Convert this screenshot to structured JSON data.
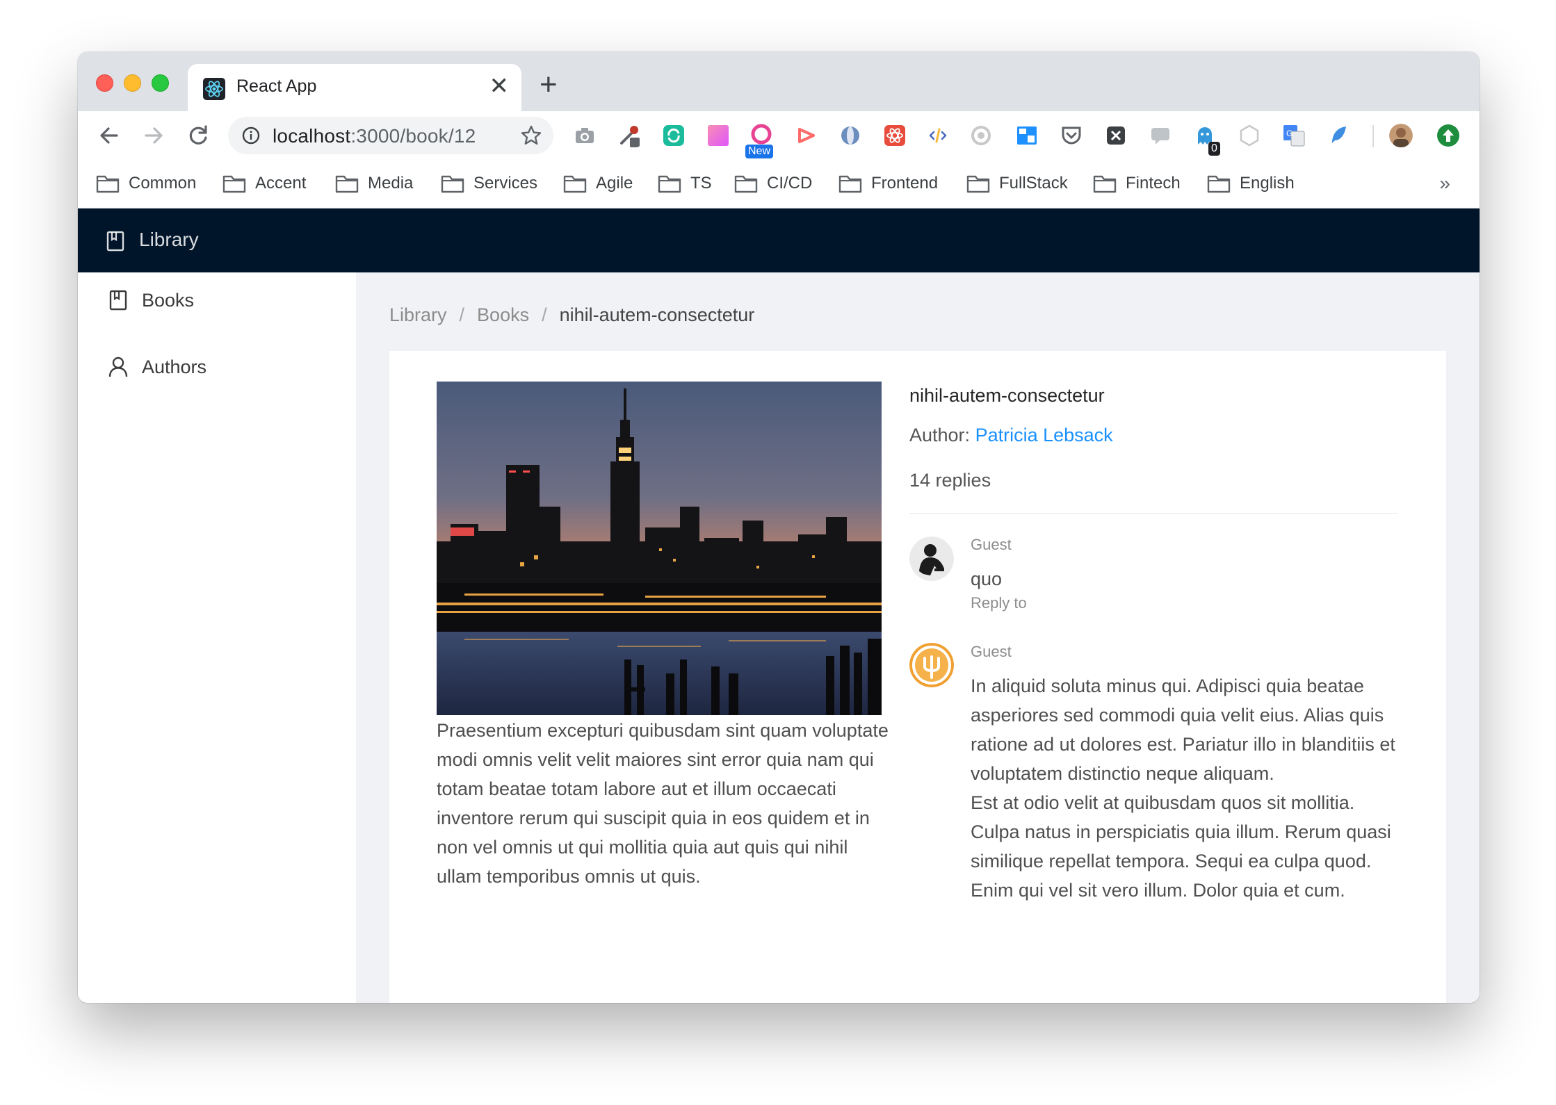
{
  "browser": {
    "tab_title": "React App",
    "tab_close": "✕",
    "new_tab": "+",
    "url_host": "localhost",
    "url_rest": ":3000/book/12",
    "extension_badge_new": "New",
    "extension_badge_count": "0",
    "more_bookmarks": "»"
  },
  "bookmarks": [
    "Common",
    "Accent",
    "Media",
    "Services",
    "Agile",
    "TS",
    "CI/CD",
    "Frontend",
    "FullStack",
    "Fintech",
    "English"
  ],
  "app": {
    "title": "Library"
  },
  "sidebar": {
    "items": [
      {
        "label": "Books",
        "icon": "book-icon"
      },
      {
        "label": "Authors",
        "icon": "user-icon"
      }
    ]
  },
  "breadcrumb": {
    "items": [
      "Library",
      "Books"
    ],
    "separator": "/",
    "current": "nihil-autem-consectetur"
  },
  "book": {
    "title": "nihil-autem-consectetur",
    "author_prefix": "Author:",
    "author_name": "Patricia Lebsack",
    "description": "Praesentium excepturi quibusdam sint quam voluptate modi omnis velit velit maiores sint error quia nam qui totam beatae totam labore aut et illum occaecati inventore rerum qui suscipit quia in eos quidem et in non vel omnis ut qui mollitia quia aut quis qui nihil ullam temporibus omnis ut quis."
  },
  "comments": {
    "count_label": "14 replies",
    "items": [
      {
        "author": "Guest",
        "body": "quo",
        "action": "Reply to"
      },
      {
        "author": "Guest",
        "body": "In aliquid soluta minus qui. Adipisci quia beatae asperiores sed commodi quia velit eius. Alias quis ratione ad ut dolores est. Pariatur illo in blanditiis et voluptatem distinctio neque aliquam.\n Est at odio velit at quibusdam quos sit mollitia. Culpa natus in perspiciatis quia illum. Rerum quasi similique repellat tempora. Sequi ea culpa quod.\n Enim qui vel sit vero illum. Dolor quia et cum."
      }
    ]
  },
  "colors": {
    "header_bg": "#001529",
    "link": "#1890ff",
    "content_bg": "#f0f2f5"
  }
}
